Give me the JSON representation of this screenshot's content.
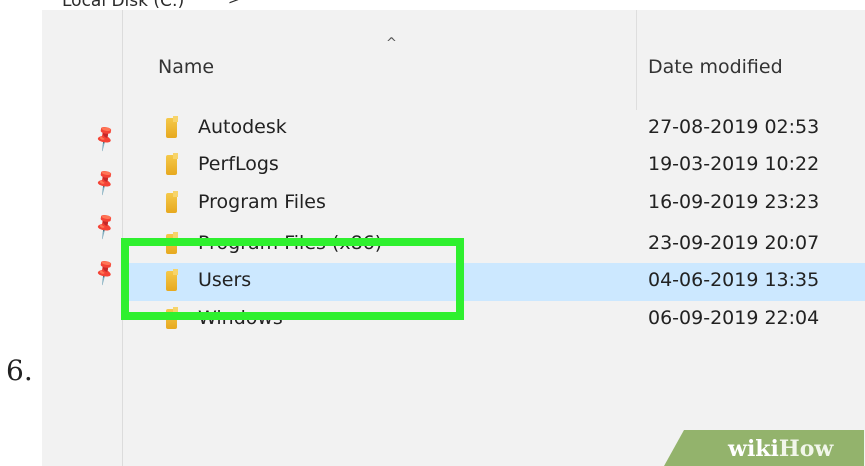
{
  "step": {
    "number": "6."
  },
  "address_bar": {
    "path": "Local Disk (C:)",
    "chevron": ">"
  },
  "header": {
    "name": "Name",
    "date": "Date modified",
    "sort_arrow": "^"
  },
  "pins": [
    "pin-icon",
    "pin-icon",
    "pin-icon",
    "pin-icon"
  ],
  "files": [
    {
      "name": "Autodesk",
      "date": "27-08-2019 02:53"
    },
    {
      "name": "PerfLogs",
      "date": "19-03-2019 10:22"
    },
    {
      "name": "Program Files",
      "date": "16-09-2019 23:23"
    },
    {
      "name": "Program Files (x86)",
      "date": "23-09-2019 20:07"
    },
    {
      "name": "Users",
      "date": "04-06-2019 13:35",
      "selected": true
    },
    {
      "name": "Windows",
      "date": "06-09-2019 22:04"
    }
  ],
  "watermark": {
    "part1": "wiki",
    "part2": "How"
  },
  "colors": {
    "highlight": "#2ff02f",
    "selection": "#cce8ff",
    "folder": "#e7a91f"
  }
}
